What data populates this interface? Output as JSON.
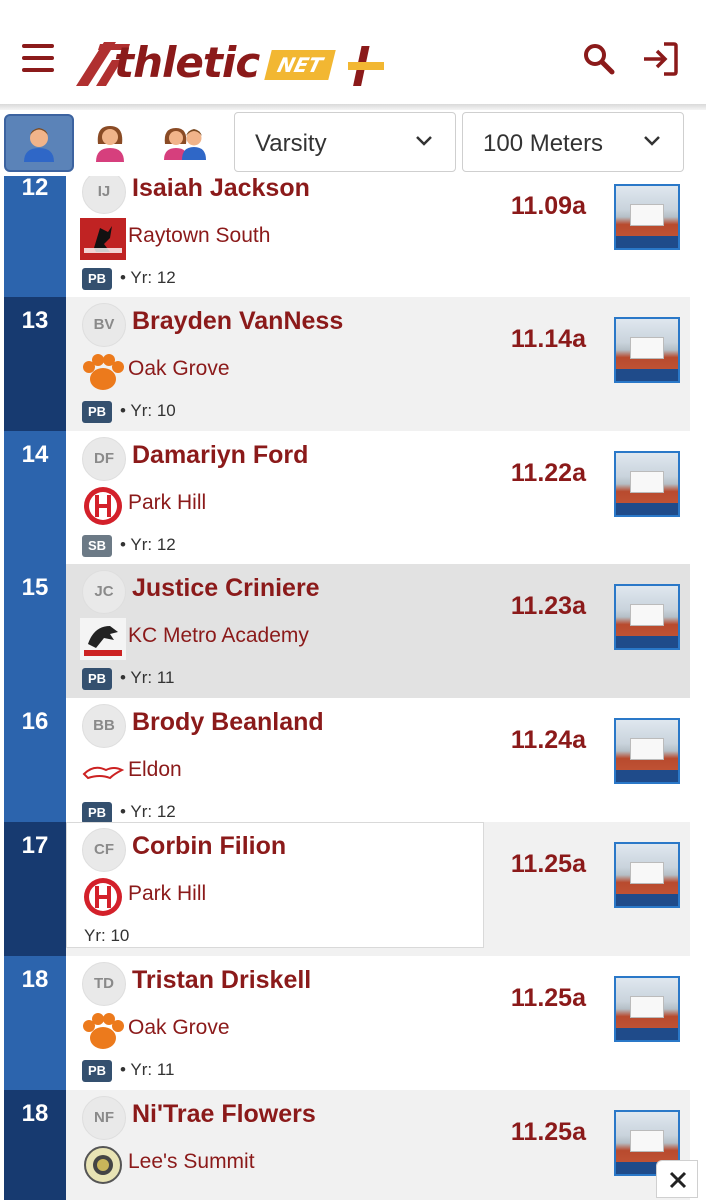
{
  "header": {
    "logo_text": "thletic",
    "logo_net": "NET",
    "icons": {
      "menu": "hamburger-icon",
      "search": "search-icon",
      "login": "login-icon"
    },
    "colors": {
      "brand": "#8b1a1a",
      "accent": "#f2b732"
    }
  },
  "filters": {
    "gender_options": [
      "boys",
      "girls",
      "all"
    ],
    "gender_selected": "boys",
    "level": "Varsity",
    "event": "100 Meters"
  },
  "athletes": [
    {
      "rank": "12",
      "initials": "IJ",
      "name": "Isaiah Jackson",
      "school": "Raytown South",
      "badge": "PB",
      "year": "• Yr: 12",
      "mark": "11.09a"
    },
    {
      "rank": "13",
      "initials": "BV",
      "name": "Brayden VanNess",
      "school": "Oak Grove",
      "badge": "PB",
      "year": "• Yr: 10",
      "mark": "11.14a"
    },
    {
      "rank": "14",
      "initials": "DF",
      "name": "Damariyn Ford",
      "school": "Park Hill",
      "badge": "SB",
      "year": "• Yr: 12",
      "mark": "11.22a"
    },
    {
      "rank": "15",
      "initials": "JC",
      "name": "Justice Criniere",
      "school": "KC Metro Academy",
      "badge": "PB",
      "year": "• Yr: 11",
      "mark": "11.23a"
    },
    {
      "rank": "16",
      "initials": "BB",
      "name": "Brody Beanland",
      "school": "Eldon",
      "badge": "PB",
      "year": "• Yr: 12",
      "mark": "11.24a"
    },
    {
      "rank": "17",
      "initials": "CF",
      "name": "Corbin Filion",
      "school": "Park Hill",
      "badge": "",
      "year": "Yr: 10",
      "mark": "11.25a"
    },
    {
      "rank": "18",
      "initials": "TD",
      "name": "Tristan Driskell",
      "school": "Oak Grove",
      "badge": "PB",
      "year": "• Yr: 11",
      "mark": "11.25a"
    },
    {
      "rank": "18",
      "initials": "NF",
      "name": "Ni'Trae Flowers",
      "school": "Lee's Summit",
      "badge": "",
      "year": "",
      "mark": "11.25a"
    }
  ],
  "close_label": "×"
}
